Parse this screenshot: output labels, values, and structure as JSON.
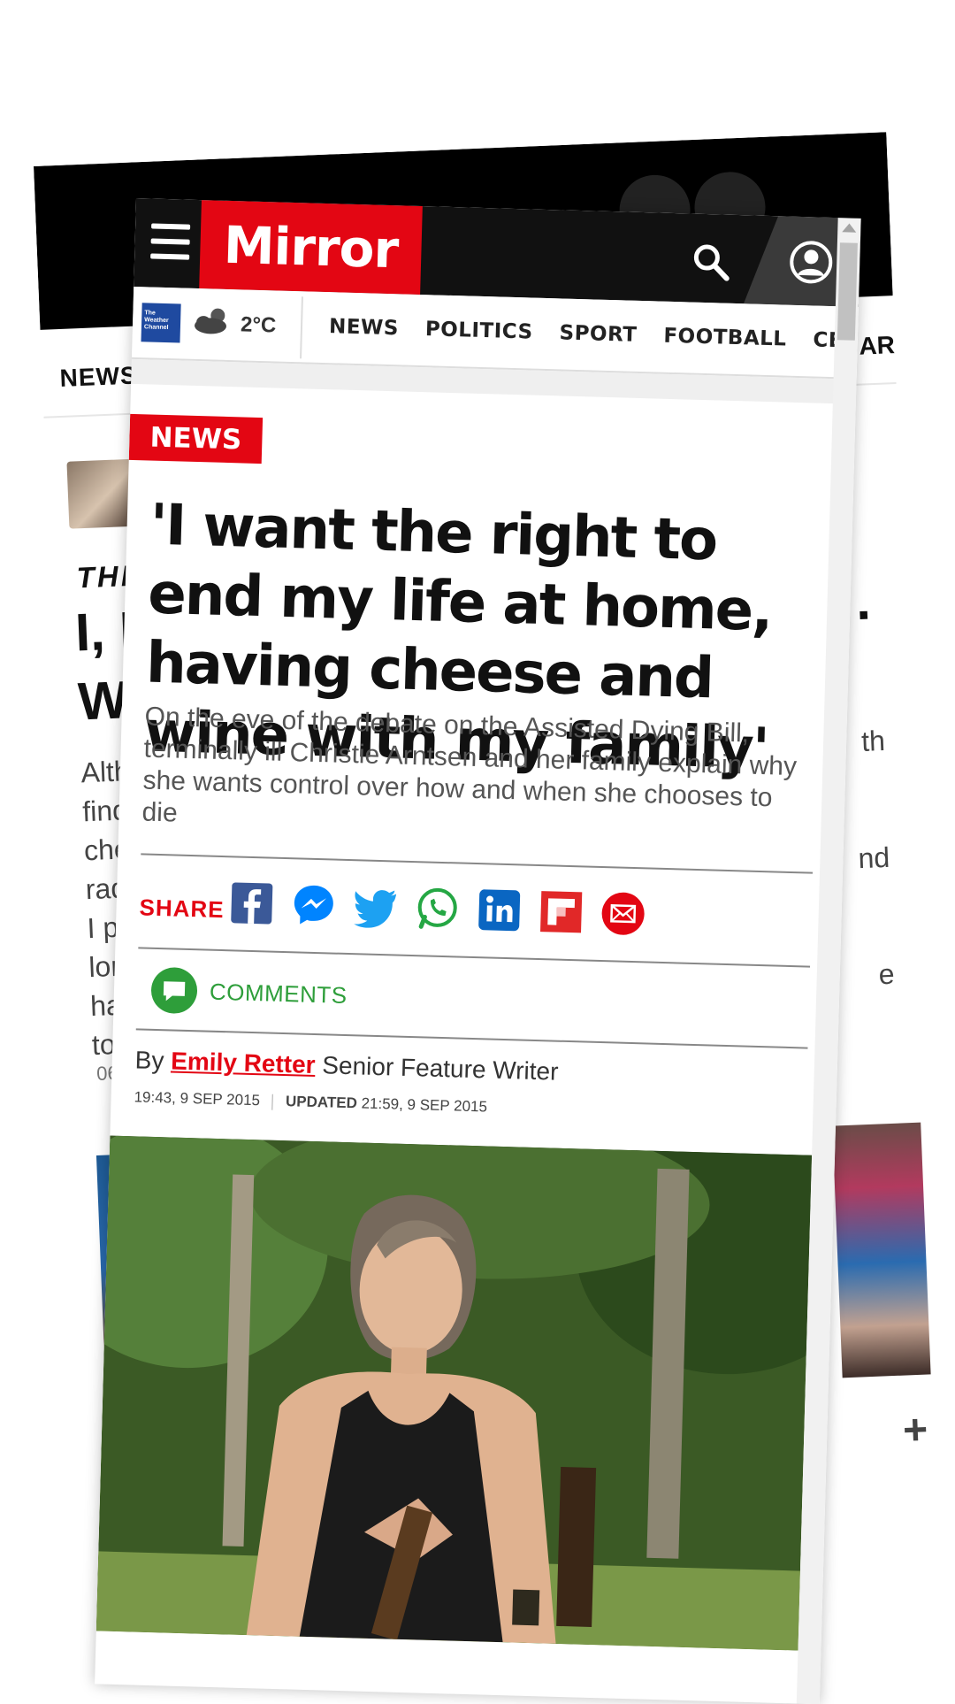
{
  "background_page": {
    "nav_news": "NEWS",
    "nav_right_fragment": "AR",
    "kicker": "THE",
    "headline_fragment": "I, Li",
    "headline_line2_fragment": "Wh",
    "headline_trailing_dot": ".",
    "standfirst_lines": [
      "Alth",
      "findi",
      "che",
      "radi",
      "I pla",
      "lon",
      "hav",
      "to"
    ],
    "standfirst_right": [
      "th",
      "nd",
      "e"
    ],
    "date_fragment": "06/1",
    "plus_label": "+"
  },
  "header": {
    "logo": "Mirror"
  },
  "weather": {
    "provider": "The Weather Channel",
    "temperature": "2°C"
  },
  "nav": {
    "links": [
      "NEWS",
      "POLITICS",
      "SPORT",
      "FOOTBALL",
      "CELEB"
    ]
  },
  "article": {
    "section_tag": "NEWS",
    "title": "'I want the right to end my life at home, having cheese and wine with my family'",
    "standfirst": "On the eve of the debate on the Assisted Dying Bill, terminally ill Christie Arntsen and her family explain why she wants control over how and when she chooses to die",
    "share_label": "SHARE",
    "comments_label": "COMMENTS",
    "byline_prefix": "By",
    "author": "Emily Retter",
    "author_role": "Senior Feature Writer",
    "published": "19:43, 9 SEP 2015",
    "updated_label": "UPDATED",
    "updated": "21:59, 9 SEP 2015"
  },
  "colors": {
    "brand_red": "#e30613",
    "header_black": "#111111",
    "comments_green": "#2e9e3a"
  },
  "icons": [
    "menu-icon",
    "search-icon",
    "account-icon",
    "weather-cloud-icon",
    "facebook-icon",
    "messenger-icon",
    "twitter-icon",
    "whatsapp-icon",
    "linkedin-icon",
    "flipboard-icon",
    "email-icon",
    "comment-bubble-icon"
  ]
}
